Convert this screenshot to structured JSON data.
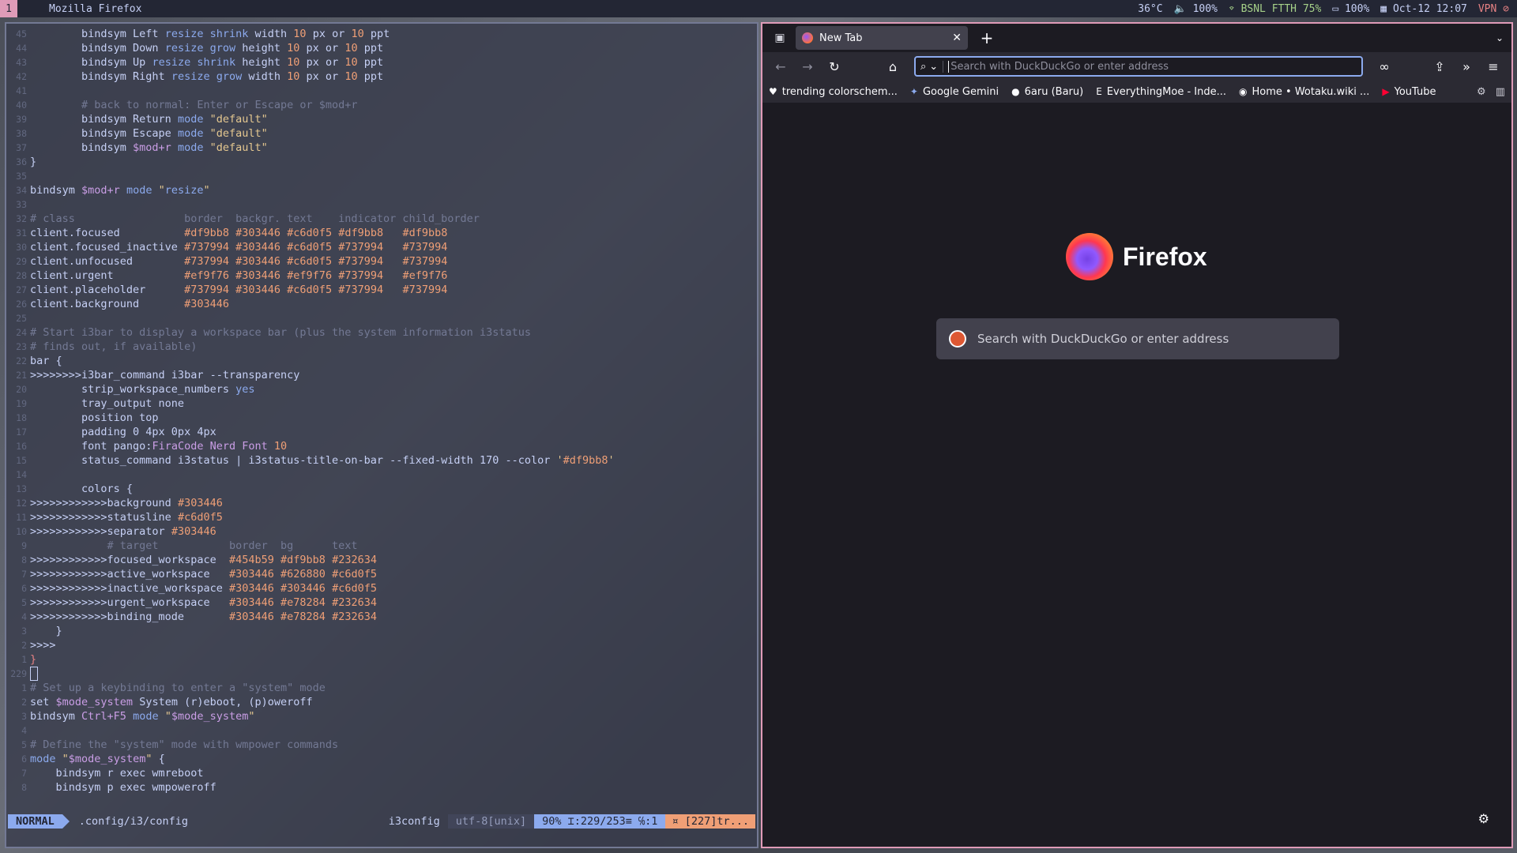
{
  "topbar": {
    "workspace": "1",
    "window_title": "Mozilla Firefox",
    "temperature": "36°C",
    "volume": "🔈 100%",
    "wifi": "BSNL FTTH 75%",
    "battery": "100%",
    "datetime": "Oct-12 12:07",
    "vpn": "VPN"
  },
  "editor": {
    "lines": [
      {
        "n": "45",
        "t": "        bindsym Left resize shrink width 10 px or 10 ppt"
      },
      {
        "n": "44",
        "t": "        bindsym Down resize grow height 10 px or 10 ppt"
      },
      {
        "n": "43",
        "t": "        bindsym Up resize shrink height 10 px or 10 ppt"
      },
      {
        "n": "42",
        "t": "        bindsym Right resize grow width 10 px or 10 ppt"
      },
      {
        "n": "41",
        "t": ""
      },
      {
        "n": "40",
        "t": "        # back to normal: Enter or Escape or $mod+r"
      },
      {
        "n": "39",
        "t": "        bindsym Return mode \"default\""
      },
      {
        "n": "38",
        "t": "        bindsym Escape mode \"default\""
      },
      {
        "n": "37",
        "t": "        bindsym $mod+r mode \"default\""
      },
      {
        "n": "36",
        "t": "}"
      },
      {
        "n": "35",
        "t": ""
      },
      {
        "n": "34",
        "t": "bindsym $mod+r mode \"resize\""
      },
      {
        "n": "33",
        "t": ""
      },
      {
        "n": "32",
        "t": "# class                 border  backgr. text    indicator child_border"
      },
      {
        "n": "31",
        "t": "client.focused          #df9bb8 #303446 #c6d0f5 #df9bb8   #df9bb8"
      },
      {
        "n": "30",
        "t": "client.focused_inactive #737994 #303446 #c6d0f5 #737994   #737994"
      },
      {
        "n": "29",
        "t": "client.unfocused        #737994 #303446 #c6d0f5 #737994   #737994"
      },
      {
        "n": "28",
        "t": "client.urgent           #ef9f76 #303446 #ef9f76 #737994   #ef9f76"
      },
      {
        "n": "27",
        "t": "client.placeholder      #737994 #303446 #c6d0f5 #737994   #737994"
      },
      {
        "n": "26",
        "t": "client.background       #303446"
      },
      {
        "n": "25",
        "t": ""
      },
      {
        "n": "24",
        "t": "# Start i3bar to display a workspace bar (plus the system information i3status"
      },
      {
        "n": "23",
        "t": "# finds out, if available)"
      },
      {
        "n": "22",
        "t": "bar {"
      },
      {
        "n": "21",
        "t": ">>>>>>>>i3bar_command i3bar --transparency"
      },
      {
        "n": "20",
        "t": "        strip_workspace_numbers yes"
      },
      {
        "n": "19",
        "t": "        tray_output none"
      },
      {
        "n": "18",
        "t": "        position top"
      },
      {
        "n": "17",
        "t": "        padding 0 4px 0px 4px"
      },
      {
        "n": "16",
        "t": "        font pango:FiraCode Nerd Font 10"
      },
      {
        "n": "15",
        "t": "        status_command i3status | i3status-title-on-bar --fixed-width 170 --color '#df9bb8'"
      },
      {
        "n": "14",
        "t": ""
      },
      {
        "n": "13",
        "t": "        colors {"
      },
      {
        "n": "12",
        "t": ">>>>>>>>>>>>background #303446"
      },
      {
        "n": "11",
        "t": ">>>>>>>>>>>>statusline #c6d0f5"
      },
      {
        "n": "10",
        "t": ">>>>>>>>>>>>separator #303446"
      },
      {
        "n": "9",
        "t": "            # target           border  bg      text"
      },
      {
        "n": "8",
        "t": ">>>>>>>>>>>>focused_workspace  #454b59 #df9bb8 #232634"
      },
      {
        "n": "7",
        "t": ">>>>>>>>>>>>active_workspace   #303446 #626880 #c6d0f5"
      },
      {
        "n": "6",
        "t": ">>>>>>>>>>>>inactive_workspace #303446 #303446 #c6d0f5"
      },
      {
        "n": "5",
        "t": ">>>>>>>>>>>>urgent_workspace   #303446 #e78284 #232634"
      },
      {
        "n": "4",
        "t": ">>>>>>>>>>>>binding_mode       #303446 #e78284 #232634"
      },
      {
        "n": "3",
        "t": "    }"
      },
      {
        "n": "2",
        "t": ">>>>"
      },
      {
        "n": "1",
        "t": "}"
      },
      {
        "n": "229",
        "t": ""
      },
      {
        "n": "1",
        "t": "# Set up a keybinding to enter a \"system\" mode"
      },
      {
        "n": "2",
        "t": "set $mode_system System (r)eboot, (p)oweroff"
      },
      {
        "n": "3",
        "t": "bindsym Ctrl+F5 mode \"$mode_system\""
      },
      {
        "n": "4",
        "t": ""
      },
      {
        "n": "5",
        "t": "# Define the \"system\" mode with wmpower commands"
      },
      {
        "n": "6",
        "t": "mode \"$mode_system\" {"
      },
      {
        "n": "7",
        "t": "    bindsym r exec wmreboot"
      },
      {
        "n": "8",
        "t": "    bindsym p exec wmpoweroff"
      }
    ],
    "status": {
      "mode": "NORMAL",
      "file": ".config/i3/config",
      "filetype": "i3config",
      "encoding": "utf-8[unix]",
      "position": "90% ⌶:229/253≡ ℅:1",
      "warning": "¤ [227]tr..."
    }
  },
  "firefox": {
    "tab_title": "New Tab",
    "url_placeholder": "Search with DuckDuckGo or enter address",
    "bookmarks": [
      {
        "icon": "bookmark-heart-icon",
        "label": "trending colorschem..."
      },
      {
        "icon": "gemini-icon",
        "label": "Google Gemini"
      },
      {
        "icon": "github-icon",
        "label": "6aru (Baru)"
      },
      {
        "icon": "e-icon",
        "label": "EverythingMoe - Inde..."
      },
      {
        "icon": "wotaku-icon",
        "label": "Home • Wotaku.wiki ..."
      },
      {
        "icon": "youtube-icon",
        "label": "YouTube"
      }
    ],
    "logo_text": "Firefox",
    "search_placeholder": "Search with DuckDuckGo or enter address",
    "accent": "#8caaee",
    "border_color": "#df9bb8"
  }
}
